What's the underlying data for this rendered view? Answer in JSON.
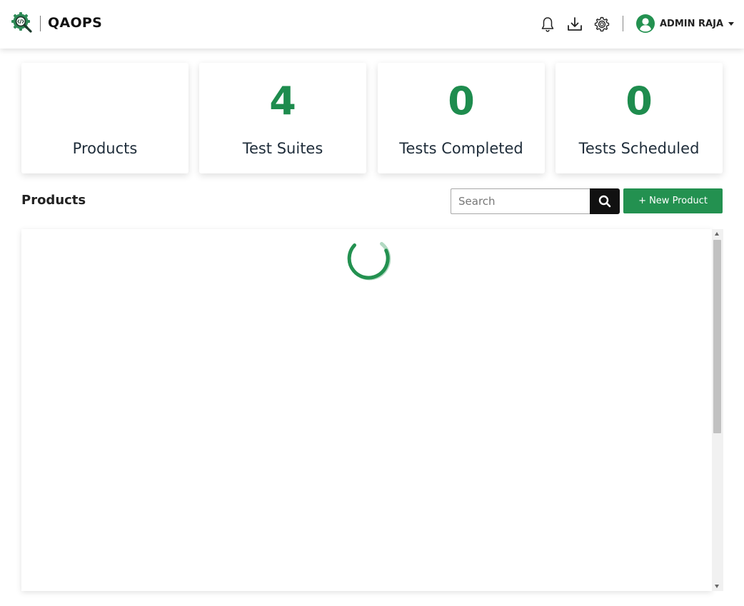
{
  "app": {
    "brand": "QAOPS",
    "accent_color": "#239150",
    "stat_color": "#1e8c4e"
  },
  "header": {
    "icons": [
      "bell-icon",
      "download-icon",
      "gear-icon"
    ],
    "user": {
      "name": "ADMIN RAJA",
      "avatar_icon": "user-circle-icon"
    }
  },
  "stats": [
    {
      "value": "",
      "label": "Products"
    },
    {
      "value": "4",
      "label": "Test Suites"
    },
    {
      "value": "0",
      "label": "Tests Completed"
    },
    {
      "value": "0",
      "label": "Tests Scheduled"
    }
  ],
  "products": {
    "title": "Products",
    "search_placeholder": "Search",
    "search_icon": "search-icon",
    "new_button_label": "+ New Product",
    "loading": true
  }
}
